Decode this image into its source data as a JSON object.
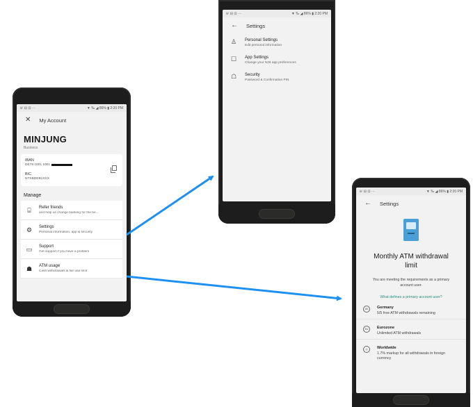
{
  "phone1": {
    "status": {
      "left": "⊮ ⊟ ⊡ ···",
      "right": "▼ ‰ ◢ 86% ▮ 2:20 PM"
    },
    "header_title": "My Account",
    "account_name": "MINJUNG",
    "account_type": "Business",
    "iban_label": "IBAN",
    "iban_value": "DE79 1001 1001",
    "bic_label": "BIC",
    "bic_value": "NTSBDEB1XXX",
    "section_title": "Manage",
    "items": [
      {
        "title": "Refer friends",
        "subtitle": "and help us change banking for the be...",
        "icon": "gift-icon",
        "glyph": "⌸"
      },
      {
        "title": "Settings",
        "subtitle": "Personal information, app & security",
        "icon": "gear-icon",
        "glyph": "⚙"
      },
      {
        "title": "Support",
        "subtitle": "Get support if you have a problem",
        "icon": "chat-icon",
        "glyph": "▭"
      },
      {
        "title": "ATM usage",
        "subtitle": "Cash withdrawals & fair use limit",
        "icon": "atm-icon",
        "glyph": "☗"
      }
    ]
  },
  "phone2": {
    "status": {
      "left": "⊮ ⊟ ⊡ ···",
      "right": "▼ ‰ ◢ 86% ▮ 2:20 PM"
    },
    "header_title": "Settings",
    "items": [
      {
        "title": "Personal Settings",
        "subtitle": "Edit personal information",
        "icon": "person-icon",
        "glyph": "♙"
      },
      {
        "title": "App Settings",
        "subtitle": "Change your N26 app preferences",
        "icon": "app-settings-icon",
        "glyph": "☐"
      },
      {
        "title": "Security",
        "subtitle": "Password & Confirmation PIN",
        "icon": "lock-icon",
        "glyph": "☖"
      }
    ]
  },
  "phone3": {
    "status": {
      "left": "⊮ ⊟ ⊡ ···",
      "right": "▼ ‰ ◢ 86% ▮ 2:20 PM"
    },
    "header_title": "Settings",
    "title": "Monthly ATM withdrawal limit",
    "subtitle": "You are meeting the requirements as a primary account user.",
    "link": "What defines a primary account user?",
    "items": [
      {
        "badge": "DE",
        "title": "Germany",
        "subtitle": "5/5 free ATM withdrawals remaining"
      },
      {
        "badge": "EU",
        "title": "Eurozone",
        "subtitle": "Unlimited ATM withdrawals"
      },
      {
        "badge": "◎",
        "title": "Worldwide",
        "subtitle": "1.7% markup for all withdrawals in foreign currency"
      }
    ]
  },
  "colors": {
    "arrow": "#1e90f0",
    "link": "#2a8c7c",
    "atm_illustration": "#4a9fd6"
  }
}
